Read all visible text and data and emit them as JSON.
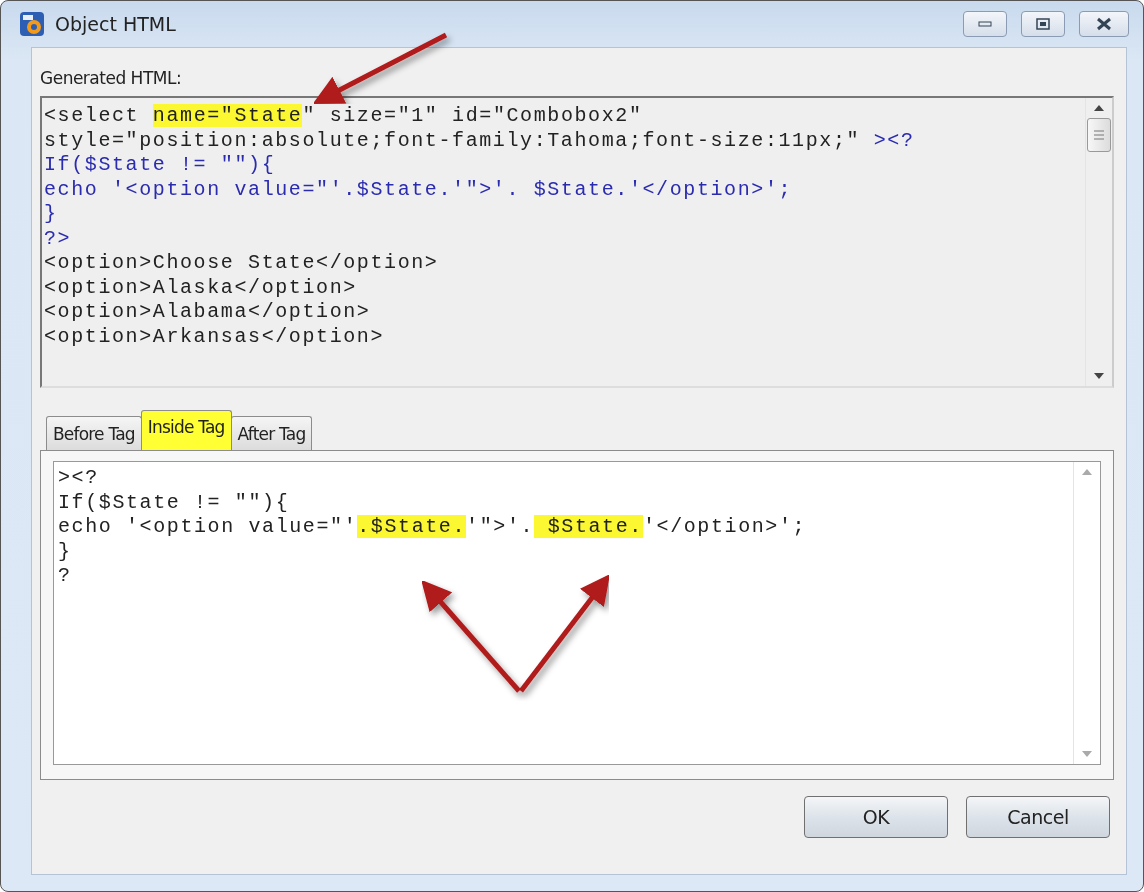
{
  "window": {
    "title": "Object HTML"
  },
  "generated_html": {
    "label": "Generated HTML:",
    "lines": [
      [
        {
          "text": "<select ",
          "kind": "html",
          "highlighted": false
        },
        {
          "text": "name=\"State",
          "kind": "html",
          "highlighted": true
        },
        {
          "text": "\" size=\"1\" id=\"Combobox2\"",
          "kind": "html",
          "highlighted": false
        }
      ],
      [
        {
          "text": "style=\"position:absolute;font-family:Tahoma;font-size:11px;\" ",
          "kind": "html",
          "highlighted": false
        },
        {
          "text": "><?",
          "kind": "php",
          "highlighted": false
        }
      ],
      [
        {
          "text": "If($State != \"\"){",
          "kind": "php",
          "highlighted": false
        }
      ],
      [
        {
          "text": "echo '<option value=\"'.$State.'\">'. $State.'</option>';",
          "kind": "php",
          "highlighted": false
        }
      ],
      [
        {
          "text": "}",
          "kind": "php",
          "highlighted": false
        }
      ],
      [
        {
          "text": "?>",
          "kind": "php",
          "highlighted": false
        }
      ],
      [
        {
          "text": "<option>Choose State</option>",
          "kind": "html",
          "highlighted": false
        }
      ],
      [
        {
          "text": "<option>Alaska</option>",
          "kind": "html",
          "highlighted": false
        }
      ],
      [
        {
          "text": "<option>Alabama</option>",
          "kind": "html",
          "highlighted": false
        }
      ],
      [
        {
          "text": "<option>Arkansas</option>",
          "kind": "html",
          "highlighted": false
        }
      ]
    ]
  },
  "tabs": [
    {
      "label": "Before Tag",
      "selected": false
    },
    {
      "label": "Inside Tag",
      "selected": true
    },
    {
      "label": "After Tag",
      "selected": false
    }
  ],
  "tag_code": {
    "lines": [
      [
        {
          "text": "><?",
          "highlighted": false
        }
      ],
      [
        {
          "text": "If($State != \"\"){",
          "highlighted": false
        }
      ],
      [
        {
          "text": "echo '<option value=\"'",
          "highlighted": false
        },
        {
          "text": ".$State.",
          "highlighted": true
        },
        {
          "text": "'\">'.",
          "highlighted": false
        },
        {
          "text": " $State.",
          "highlighted": true
        },
        {
          "text": "'</option>';",
          "highlighted": false
        }
      ],
      [
        {
          "text": "}",
          "highlighted": false
        }
      ],
      [
        {
          "text": "?",
          "highlighted": false
        }
      ]
    ]
  },
  "buttons": [
    {
      "label": "OK"
    },
    {
      "label": "Cancel"
    }
  ]
}
